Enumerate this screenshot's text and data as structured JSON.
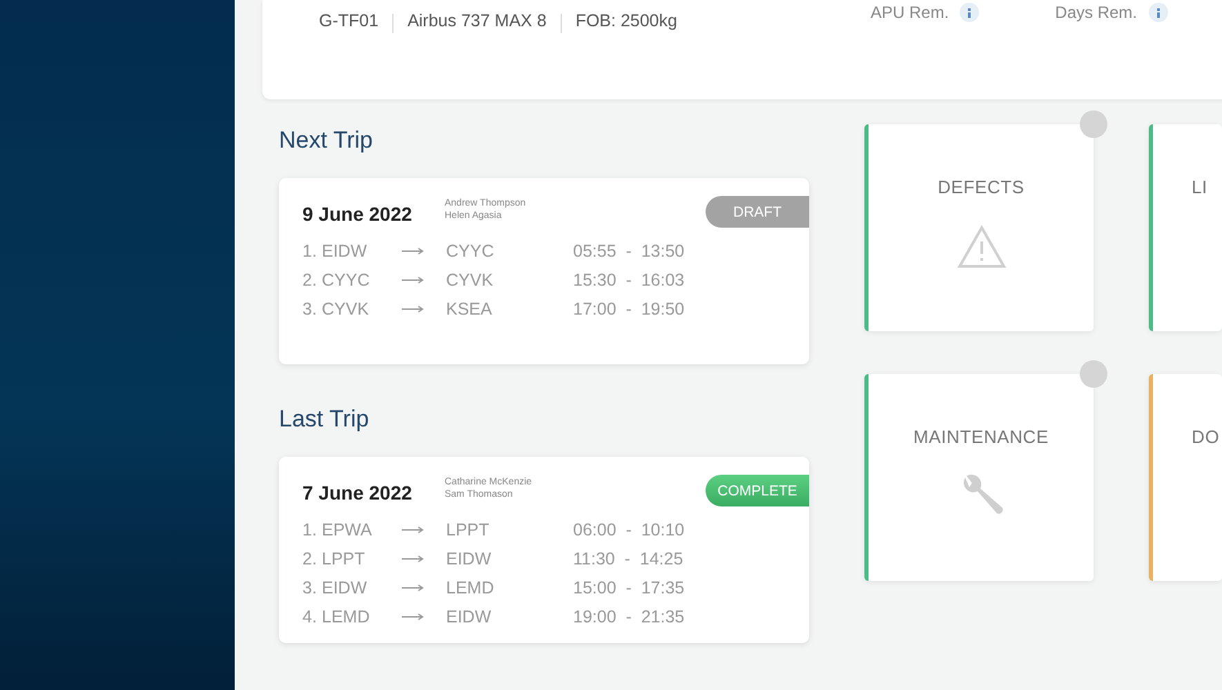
{
  "aircraft": {
    "registration": "G-TF01",
    "type": "Airbus 737 MAX 8",
    "fob": "FOB: 2500kg",
    "stats": [
      {
        "label": "APU Rem."
      },
      {
        "label": "Days Rem."
      }
    ]
  },
  "trips": [
    {
      "heading": "Next Trip",
      "date": "9 June 2022",
      "crew": [
        "Andrew Thompson",
        "Helen Agasia"
      ],
      "status": {
        "label": "DRAFT",
        "kind": "draft"
      },
      "legs": [
        {
          "num": "1.",
          "from": "EIDW",
          "to": "CYYC",
          "time": "05:55  -  13:50"
        },
        {
          "num": "2.",
          "from": "CYYC",
          "to": "CYVK",
          "time": "15:30  -  16:03"
        },
        {
          "num": "3.",
          "from": "CYVK",
          "to": "KSEA",
          "time": "17:00  -  19:50"
        }
      ]
    },
    {
      "heading": "Last Trip",
      "date": "7 June 2022",
      "crew": [
        "Catharine McKenzie",
        "Sam Thomason"
      ],
      "status": {
        "label": "COMPLETE",
        "kind": "complete"
      },
      "legs": [
        {
          "num": "1.",
          "from": "EPWA",
          "to": "LPPT",
          "time": "06:00  -  10:10"
        },
        {
          "num": "2.",
          "from": "LPPT",
          "to": "EIDW",
          "time": "11:30  -  14:25"
        },
        {
          "num": "3.",
          "from": "EIDW",
          "to": "LEMD",
          "time": "15:00  -  17:35"
        },
        {
          "num": "4.",
          "from": "LEMD",
          "to": "EIDW",
          "time": "19:00  -  21:35"
        }
      ]
    }
  ],
  "tiles": [
    [
      {
        "label": "DEFECTS",
        "color": "#4cbb85",
        "kind": "warning"
      },
      {
        "label": "LI",
        "color": "#4cbb85",
        "kind": "none"
      }
    ],
    [
      {
        "label": "MAINTENANCE",
        "color": "#4cbb85",
        "kind": "wrench"
      },
      {
        "label": "DO",
        "color": "#e9b262",
        "kind": "none"
      }
    ]
  ]
}
